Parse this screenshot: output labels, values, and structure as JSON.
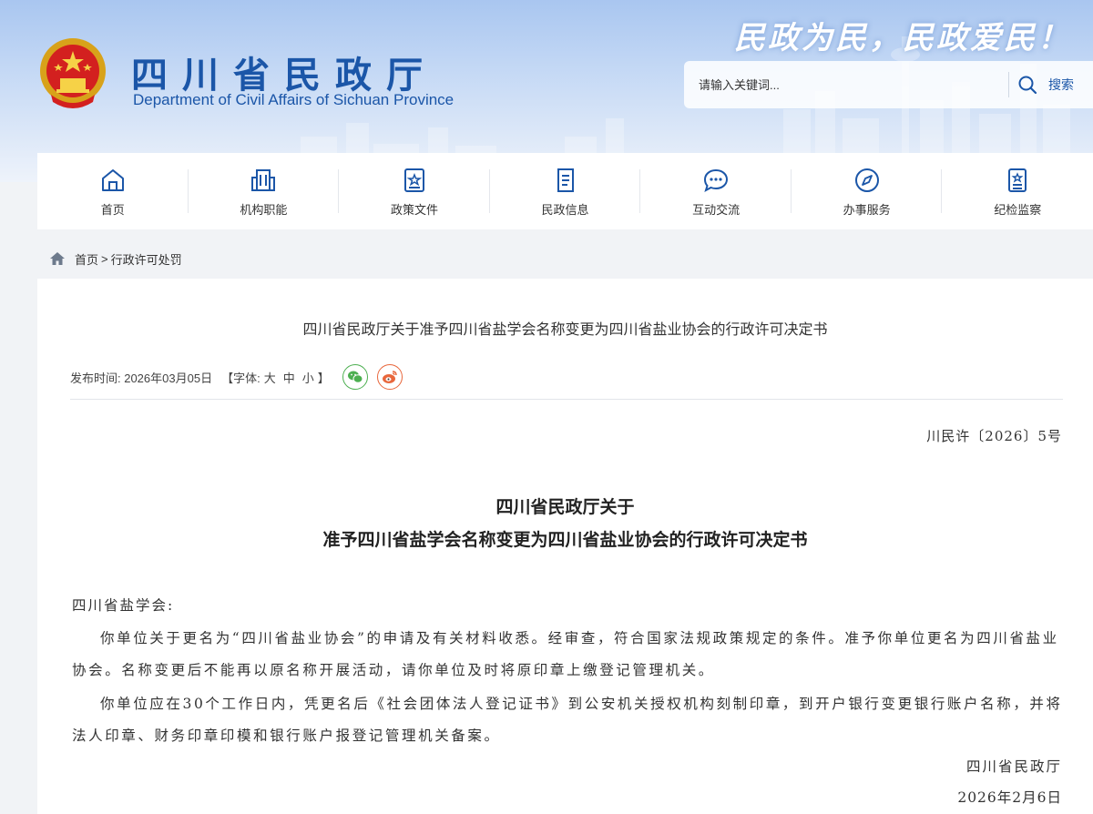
{
  "header": {
    "site_title": "四川省民政厅",
    "site_subtitle": "Department of Civil Affairs of Sichuan Province",
    "slogan": "民政为民，民政爱民！",
    "search_placeholder": "请输入关键词...",
    "search_button": "搜索"
  },
  "nav": {
    "items": [
      {
        "label": "首页",
        "icon": "home-icon"
      },
      {
        "label": "机构职能",
        "icon": "building-icon"
      },
      {
        "label": "政策文件",
        "icon": "policy-doc-icon"
      },
      {
        "label": "民政信息",
        "icon": "news-doc-icon"
      },
      {
        "label": "互动交流",
        "icon": "chat-icon"
      },
      {
        "label": "办事服务",
        "icon": "compass-icon"
      },
      {
        "label": "纪检监察",
        "icon": "inspection-icon"
      }
    ]
  },
  "breadcrumb": {
    "home": "首页",
    "separator": ">",
    "current": "行政许可处罚"
  },
  "article": {
    "title": "四川省民政厅关于准予四川省盐学会名称变更为四川省盐业协会的行政许可决定书",
    "publish_label": "发布时间: 2026年03月05日",
    "font_label_open": "【字体:",
    "font_large": "大",
    "font_medium": "中",
    "font_small": "小",
    "font_label_close": "】",
    "doc_number": "川民许〔2026〕5号",
    "heading_line1": "四川省民政厅关于",
    "heading_line2": "准予四川省盐学会名称变更为四川省盐业协会的行政许可决定书",
    "addressee": "四川省盐学会:",
    "para1": "你单位关于更名为“四川省盐业协会”的申请及有关材料收悉。经审查，符合国家法规政策规定的条件。准予你单位更名为四川省盐业协会。名称变更后不能再以原名称开展活动，请你单位及时将原印章上缴登记管理机关。",
    "para2": "你单位应在30个工作日内，凭更名后《社会团体法人登记证书》到公安机关授权机构刻制印章，到开户银行变更银行账户名称，并将法人印章、财务印章印模和银行账户报登记管理机关备案。",
    "sign_org": "四川省民政厅",
    "sign_date": "2026年2月6日"
  },
  "colors": {
    "brand_blue": "#1b56a8",
    "wechat_green": "#4caf50",
    "weibo_orange": "#e8673c"
  }
}
